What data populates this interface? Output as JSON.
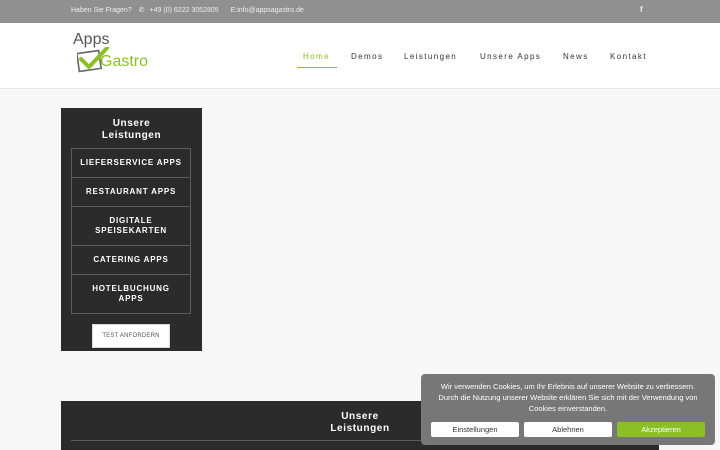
{
  "topbar": {
    "question": "Haben Sie Fragen?",
    "phone": "+49 (0) 6222 3052805",
    "email": "E:info@appsagastro.de",
    "social_icon": "facebook-icon"
  },
  "logo": {
    "line1": "Apps",
    "line2": "Gastro",
    "check_color": "#8cbf26"
  },
  "nav": {
    "items": [
      "Home",
      "Demos",
      "Leistungen",
      "Unsere Apps",
      "News",
      "Kontakt"
    ],
    "active": "Home"
  },
  "sidebar": {
    "title_line1": "Unsere",
    "title_line2": "Leistungen",
    "services": [
      [
        "LIEFERSERVICE APPS"
      ],
      [
        "RESTAURANT APPS"
      ],
      [
        "DIGITALE",
        "SPEISEKARTEN"
      ],
      [
        "CATERING APPS"
      ],
      [
        "HOTELBUCHUNG",
        "APPS"
      ]
    ],
    "cta": "TEST ANFORDERN"
  },
  "lower_panel": {
    "title_line1": "Unsere",
    "title_line2": "Leistungen"
  },
  "cookie": {
    "message": "Wir verwenden Cookies, um Ihr Erlebnis auf unserer Website zu verbessern. Durch die Nutzung unserer Website erklären Sie sich mit der Verwendung von Cookies einverstanden.",
    "settings": "Einstellungen",
    "reject": "Ablehnen",
    "accept": "Akzeptieren"
  },
  "colors": {
    "accent": "#8cbf26",
    "panel": "#2b2b2b",
    "topbar": "#909090",
    "cookie_bg": "#777777"
  }
}
